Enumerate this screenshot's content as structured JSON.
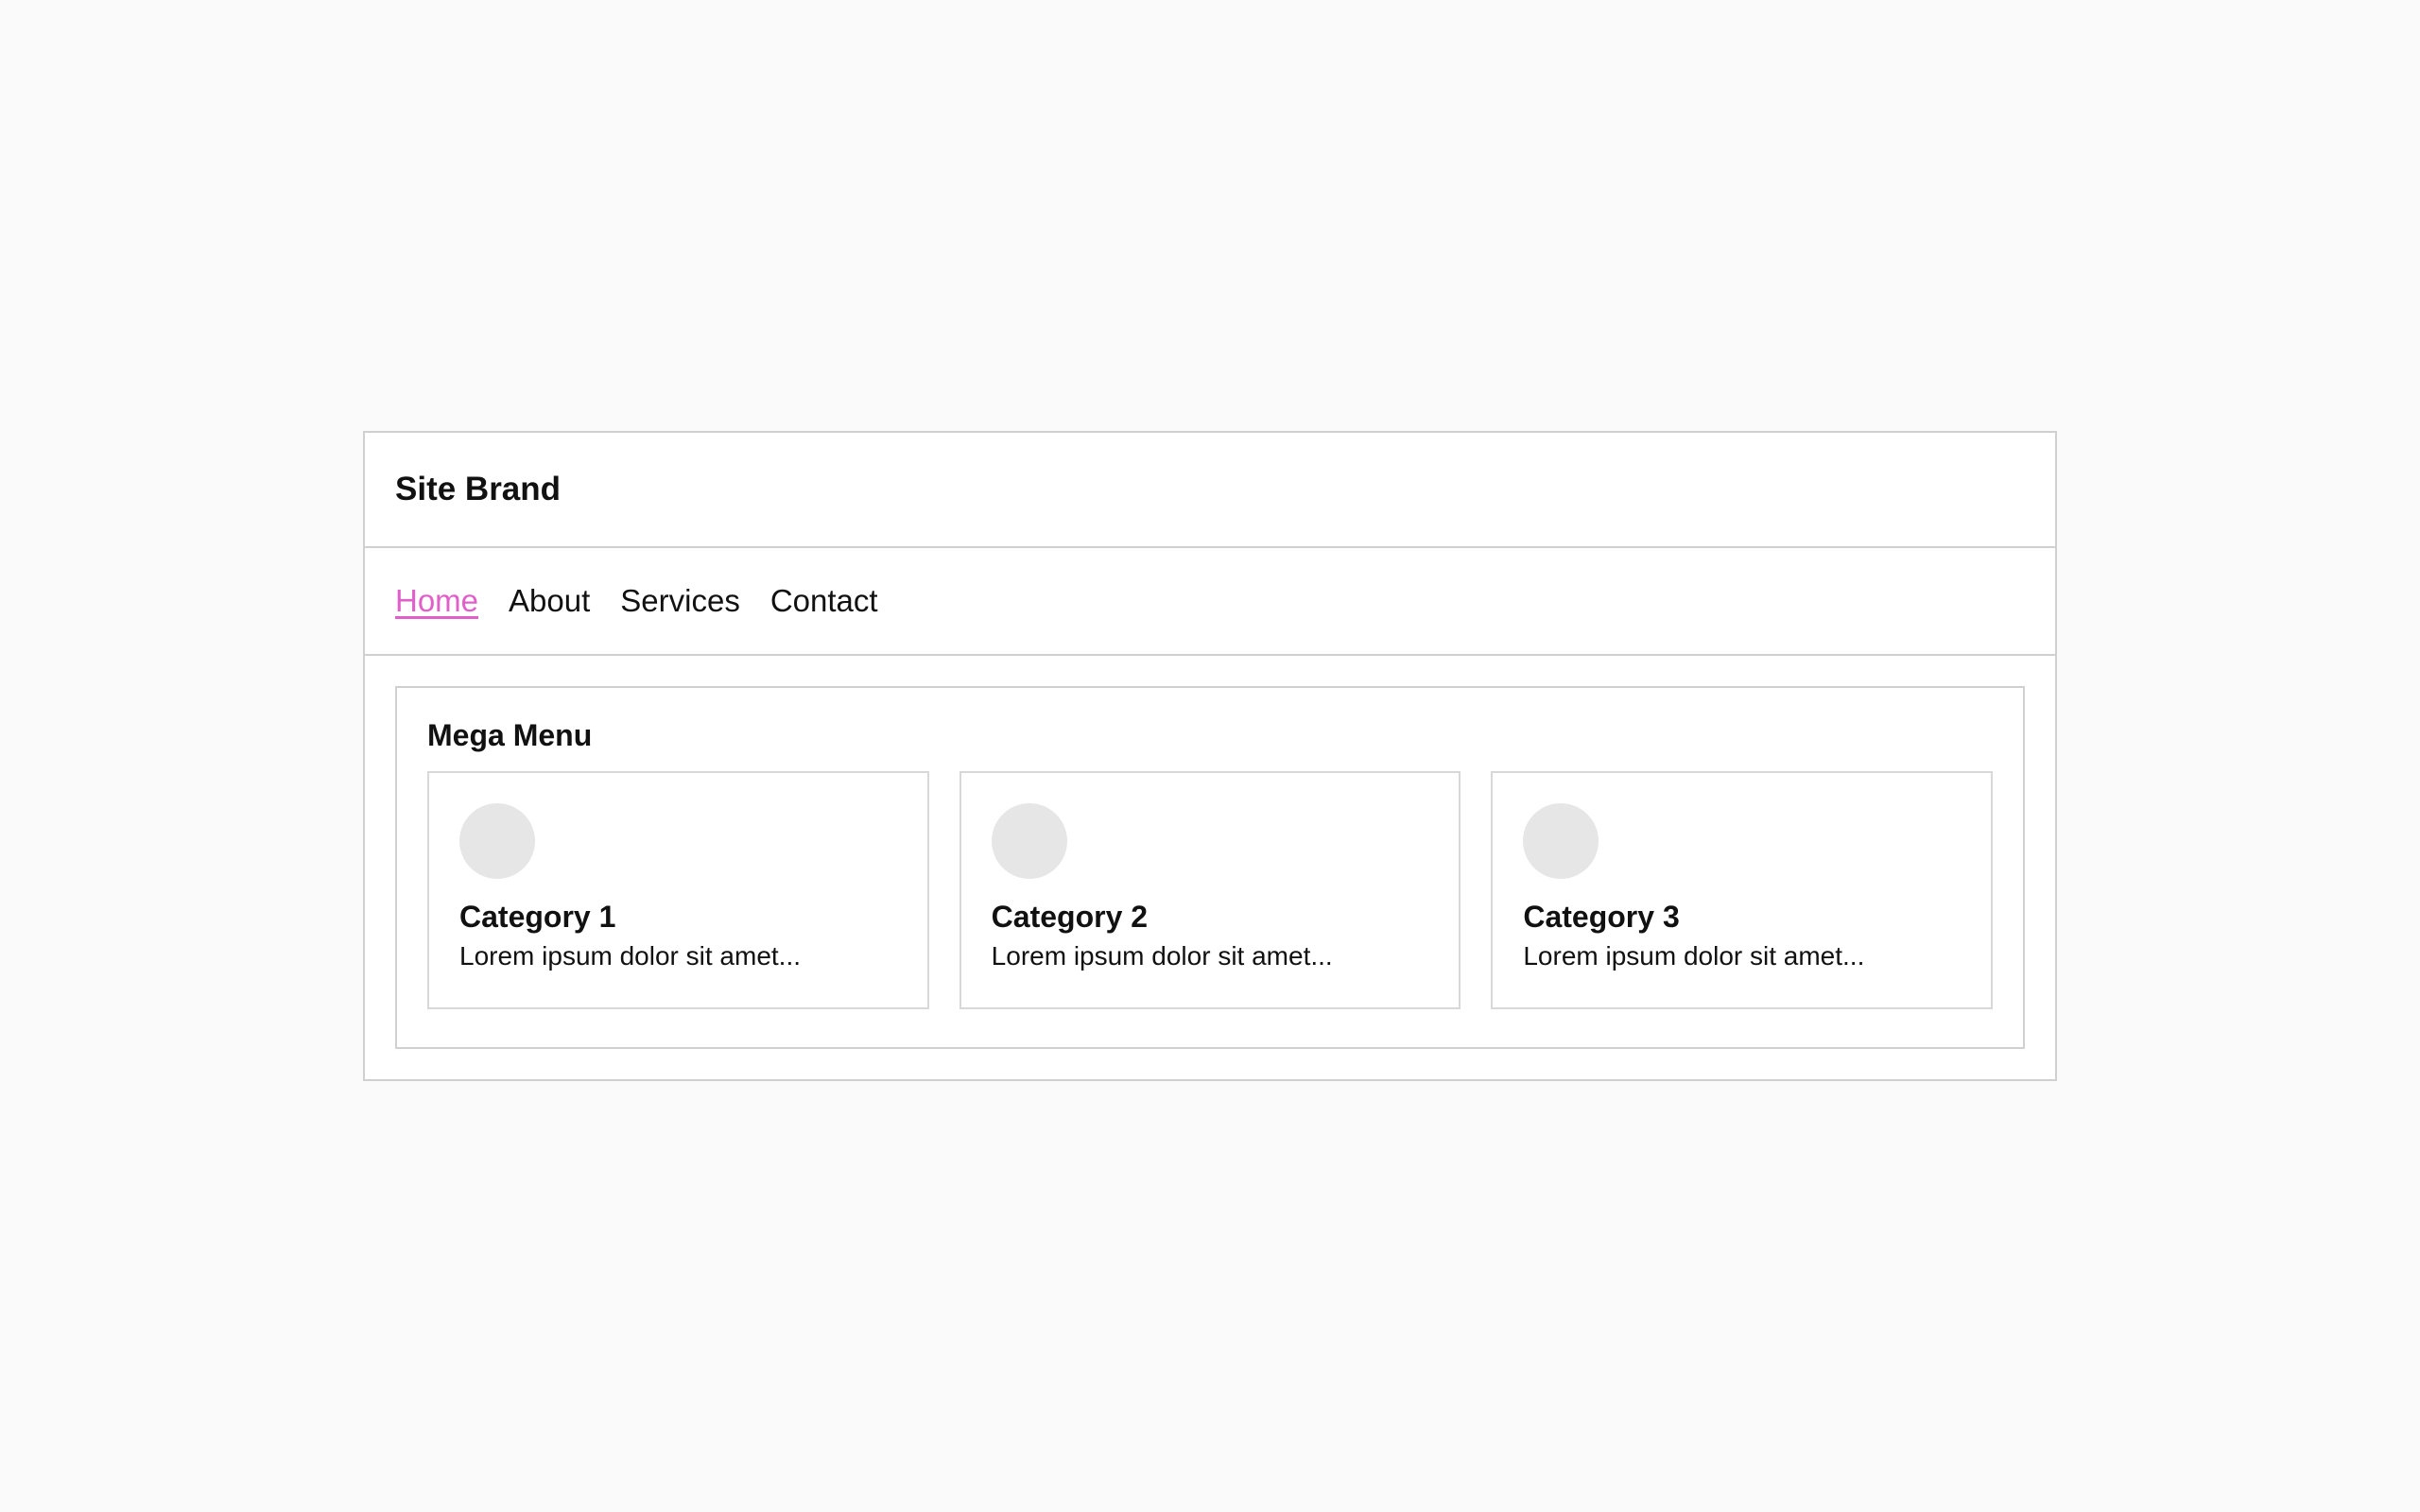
{
  "header": {
    "brand": "Site Brand"
  },
  "nav": {
    "items": [
      {
        "label": "Home",
        "active": true
      },
      {
        "label": "About",
        "active": false
      },
      {
        "label": "Services",
        "active": false
      },
      {
        "label": "Contact",
        "active": false
      }
    ]
  },
  "mega_menu": {
    "title": "Mega Menu",
    "cards": [
      {
        "icon": "circle-placeholder-icon",
        "title": "Category 1",
        "description": "Lorem ipsum dolor sit amet..."
      },
      {
        "icon": "circle-placeholder-icon",
        "title": "Category 2",
        "description": "Lorem ipsum dolor sit amet..."
      },
      {
        "icon": "circle-placeholder-icon",
        "title": "Category 3",
        "description": "Lorem ipsum dolor sit amet..."
      }
    ]
  },
  "colors": {
    "page_background": "#fafafa",
    "active_link": "#e05fc9",
    "border": "#d0d0d0",
    "icon_placeholder": "#e6e6e6",
    "text": "#111111"
  }
}
